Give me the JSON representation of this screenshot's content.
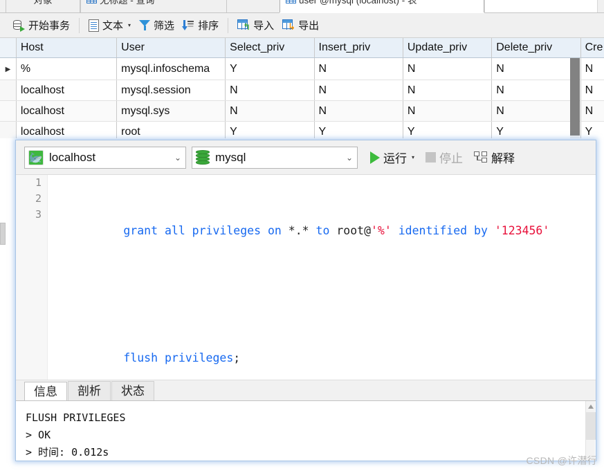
{
  "window": {
    "tabs": [
      {
        "label": "对象",
        "icon": "",
        "active": false
      },
      {
        "label": "无标题 - 查询",
        "icon": "grid-icon",
        "active": false
      },
      {
        "label": "user @mysql (localhost) - 表",
        "icon": "grid-icon",
        "active": true
      },
      {
        "label": "",
        "icon": "",
        "active": false
      }
    ]
  },
  "toolbar": {
    "begin_transaction": "开始事务",
    "text": "文本",
    "text_caret": "▾",
    "filter": "筛选",
    "sort": "排序",
    "import": "导入",
    "export": "导出"
  },
  "grid": {
    "columns": [
      "Host",
      "User",
      "Select_priv",
      "Insert_priv",
      "Update_priv",
      "Delete_priv",
      "Cre"
    ],
    "rows": [
      {
        "marker": "▶",
        "cells": [
          "%",
          "mysql.infoschema",
          "Y",
          "N",
          "N",
          "N",
          "N"
        ]
      },
      {
        "marker": "",
        "cells": [
          "localhost",
          "mysql.session",
          "N",
          "N",
          "N",
          "N",
          "N"
        ]
      },
      {
        "marker": "",
        "cells": [
          "localhost",
          "mysql.sys",
          "N",
          "N",
          "N",
          "N",
          "N"
        ]
      },
      {
        "marker": "",
        "cells": [
          "localhost",
          "root",
          "Y",
          "Y",
          "Y",
          "Y",
          "Y"
        ]
      }
    ]
  },
  "query_panel": {
    "connection": "localhost",
    "connection_chevron": "⌄",
    "database": "mysql",
    "database_chevron": "⌄",
    "run_label": "运行",
    "run_caret": "▾",
    "stop_label": "停止",
    "explain_label": "解释",
    "editor": {
      "line_numbers": [
        "1",
        "2",
        "3"
      ],
      "lines": [
        [
          {
            "t": "grant all privileges on ",
            "c": "kw"
          },
          {
            "t": "*.* ",
            "c": "pln"
          },
          {
            "t": "to ",
            "c": "kw"
          },
          {
            "t": "root@",
            "c": "pln"
          },
          {
            "t": "'%'",
            "c": "str"
          },
          {
            "t": " identified by ",
            "c": "kw"
          },
          {
            "t": "'123456'",
            "c": "str"
          }
        ],
        [],
        [
          {
            "t": "flush privileges",
            "c": "kw"
          },
          {
            "t": ";",
            "c": "pln"
          }
        ]
      ]
    },
    "result_tabs": [
      {
        "label": "信息",
        "active": true
      },
      {
        "label": "剖析",
        "active": false
      },
      {
        "label": "状态",
        "active": false
      }
    ],
    "result_output": [
      "FLUSH PRIVILEGES",
      "> OK",
      "> 时间: 0.012s"
    ]
  },
  "watermark": "CSDN @许潜行",
  "colors": {
    "accent_blue": "#2a76c6",
    "keyword_blue": "#1769f0",
    "string_red": "#e8103a",
    "run_green": "#3dbb3d",
    "header_blue": "#e8f0f8"
  }
}
